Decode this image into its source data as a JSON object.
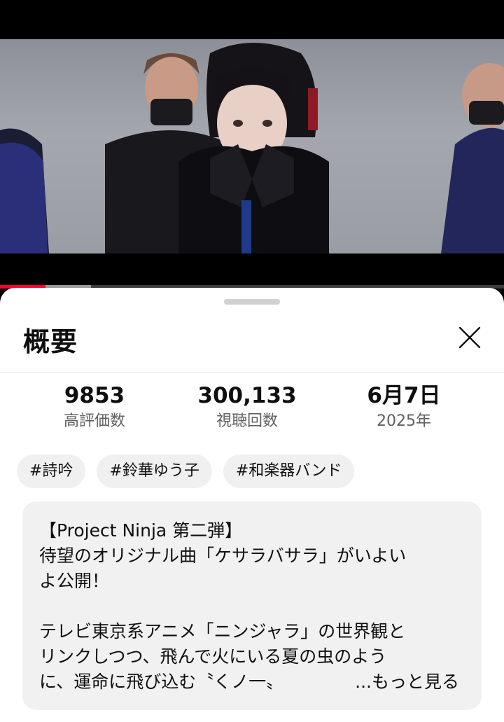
{
  "video": {
    "progress_played": 0.09,
    "progress_buffered": 0.18
  },
  "sheet": {
    "title": "概要",
    "close_icon": "close-icon"
  },
  "stats": [
    {
      "value": "9853",
      "label": "高評価数"
    },
    {
      "value": "300,133",
      "label": "視聴回数"
    },
    {
      "value": "6月7日",
      "label": "2025年"
    }
  ],
  "tags": [
    "#詩吟",
    "#鈴華ゆう子",
    "#和楽器バンド"
  ],
  "description": {
    "lines": [
      "【Project Ninja 第二弾】",
      "待望のオリジナル曲「ケサラバサラ」がいよい",
      "よ公開！",
      "",
      "テレビ東京系アニメ「ニンジャラ」の世界観と",
      "リンクしつつ、飛んで火にいる夏の虫のよう",
      "に、運命に飛び込む〝くノ一〟"
    ],
    "more_label": "...もっと見る"
  },
  "colors": {
    "accent": "#ff0033",
    "chip_bg": "#f0f0f0",
    "box_bg": "#f1f1f1"
  }
}
